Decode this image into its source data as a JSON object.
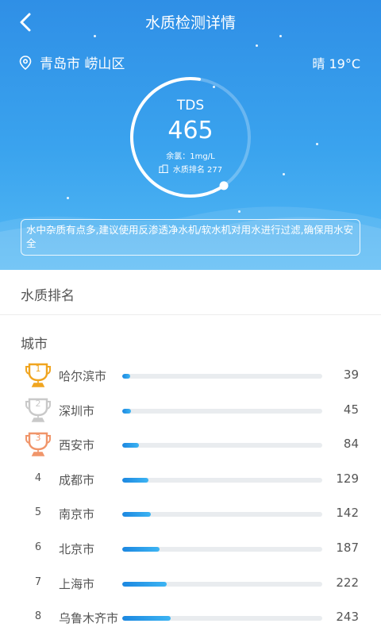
{
  "header": {
    "title": "水质检测详情",
    "location": "青岛市 崂山区",
    "weather": "晴 19°C"
  },
  "gauge": {
    "label": "TDS",
    "value": "465",
    "residual_chlorine": "余氯：1mg/L",
    "rank_text": "水质排名 277",
    "progress_fraction": 0.62
  },
  "advice": "水中杂质有点多,建议使用反渗透净水机/软水机对用水进行过滤,确保用水安全",
  "ranking": {
    "section_title": "水质排名",
    "column_header": "城市",
    "max_value": 1000,
    "rows": [
      {
        "rank": "1",
        "city": "哈尔滨市",
        "value": 39,
        "medal": "gold"
      },
      {
        "rank": "2",
        "city": "深圳市",
        "value": 45,
        "medal": "silver"
      },
      {
        "rank": "3",
        "city": "西安市",
        "value": 84,
        "medal": "bronze"
      },
      {
        "rank": "4",
        "city": "成都市",
        "value": 129,
        "medal": ""
      },
      {
        "rank": "5",
        "city": "南京市",
        "value": 142,
        "medal": ""
      },
      {
        "rank": "6",
        "city": "北京市",
        "value": 187,
        "medal": ""
      },
      {
        "rank": "7",
        "city": "上海市",
        "value": 222,
        "medal": ""
      },
      {
        "rank": "8",
        "city": "乌鲁木齐市",
        "value": 243,
        "medal": ""
      }
    ]
  },
  "colors": {
    "gold": "#f0a520",
    "silver": "#c9c9c9",
    "bronze": "#f0956a",
    "accent": "#2f8fe6"
  }
}
